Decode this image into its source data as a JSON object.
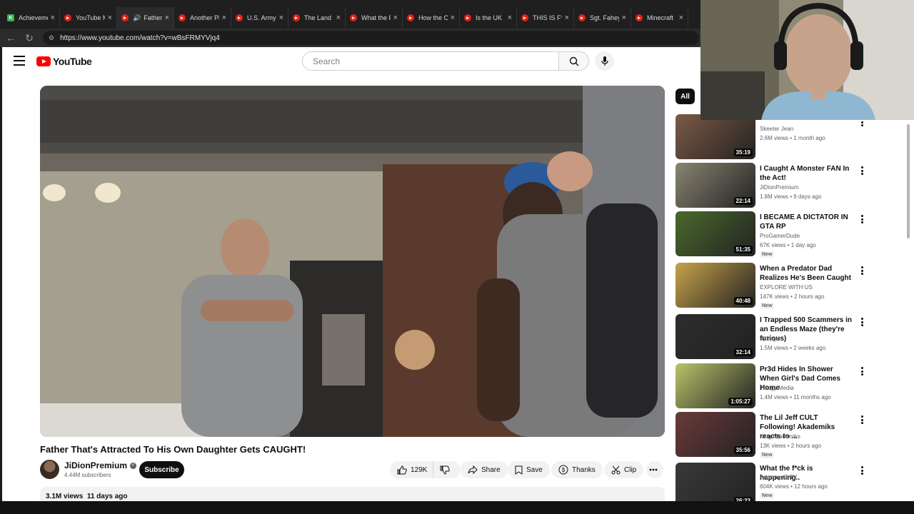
{
  "browser": {
    "tabs": [
      {
        "title": "Achievements",
        "favicon": "K",
        "color": "#3cb054"
      },
      {
        "title": "YouTube Music",
        "favicon": "yt",
        "color": "#e62117"
      },
      {
        "title": "Father",
        "favicon": "yt",
        "color": "#e62117",
        "muted": true
      },
      {
        "title": "Another Play",
        "favicon": "yt",
        "color": "#e62117"
      },
      {
        "title": "U.S. Army",
        "favicon": "yt",
        "color": "#e62117"
      },
      {
        "title": "The Land",
        "favicon": "yt",
        "color": "#e62117"
      },
      {
        "title": "What the F",
        "favicon": "yt",
        "color": "#e62117"
      },
      {
        "title": "How the C",
        "favicon": "yt",
        "color": "#e62117"
      },
      {
        "title": "Is the UK",
        "favicon": "yt",
        "color": "#e62117"
      },
      {
        "title": "THIS IS F**",
        "favicon": "yt",
        "color": "#e62117"
      },
      {
        "title": "Sgt. Fahey",
        "favicon": "yt",
        "color": "#e62117"
      },
      {
        "title": "Minecraft",
        "favicon": "yt",
        "color": "#e62117"
      }
    ],
    "url": "https://www.youtube.com/watch?v=wBsFRMYVjq4"
  },
  "masthead": {
    "logo_text": "YouTube",
    "search_placeholder": "Search"
  },
  "video": {
    "title": "Father That's Attracted To His Own Daughter Gets CAUGHT!",
    "channel": "JiDionPremium",
    "subscribers": "4.44M subscribers",
    "subscribe_label": "Subscribe",
    "likes": "129K",
    "share_label": "Share",
    "save_label": "Save",
    "thanks_label": "Thanks",
    "clip_label": "Clip",
    "views": "3.1M views",
    "age": "11 days ago"
  },
  "sidebar": {
    "chip_all": "All",
    "recommendations": [
      {
        "title": "",
        "channel": "Skeeter Jean",
        "meta": "2.6M views • 1 month ago",
        "duration": "35:19",
        "new": "",
        "thumb": "#7d5a46"
      },
      {
        "title": "I Caught A Monster FAN In the Act!",
        "channel": "JiDionPremium",
        "meta": "1.8M views • 9 days ago",
        "duration": "22:14",
        "new": "",
        "thumb": "#8a8572"
      },
      {
        "title": "I BECAME A DICTATOR IN GTA RP",
        "channel": "ProGamerDude",
        "meta": "67K views • 1 day ago",
        "duration": "51:35",
        "new": "New",
        "thumb": "#4a6a2c"
      },
      {
        "title": "When a Predator Dad Realizes He's Been Caught",
        "channel": "EXPLORE WITH US",
        "meta": "147K views • 2 hours ago",
        "duration": "40:48",
        "new": "New",
        "thumb": "#c7a24a"
      },
      {
        "title": "I Trapped 500 Scammers in an Endless Maze (they're furious)",
        "channel": "Kitboga",
        "meta": "1.5M views • 2 weeks ago",
        "duration": "32:14",
        "new": "",
        "thumb": "#2d2d2d"
      },
      {
        "title": "Pr3d Hides In Shower When Girl's Dad Comes Home",
        "channel": "Trilogy Media",
        "meta": "1.4M views • 11 months ago",
        "duration": "1:05:27",
        "new": "",
        "thumb": "#b9c46a"
      },
      {
        "title": "The Lil Jeff CULT Following! Akademiks reacts to ...",
        "channel": "King Akademiks",
        "meta": "13K views • 2 hours ago",
        "duration": "35:56",
        "new": "New",
        "thumb": "#6b3a3a"
      },
      {
        "title": "What the f*ck is happening..",
        "channel": "Asmongold TV",
        "meta": "604K views • 12 hours ago",
        "duration": "26:23",
        "new": "New",
        "thumb": "#3a3a3a"
      }
    ]
  },
  "colors": {
    "accent": "#ff0000",
    "text": "#0f0f0f",
    "muted": "#606060",
    "chip": "#f2f2f2"
  }
}
